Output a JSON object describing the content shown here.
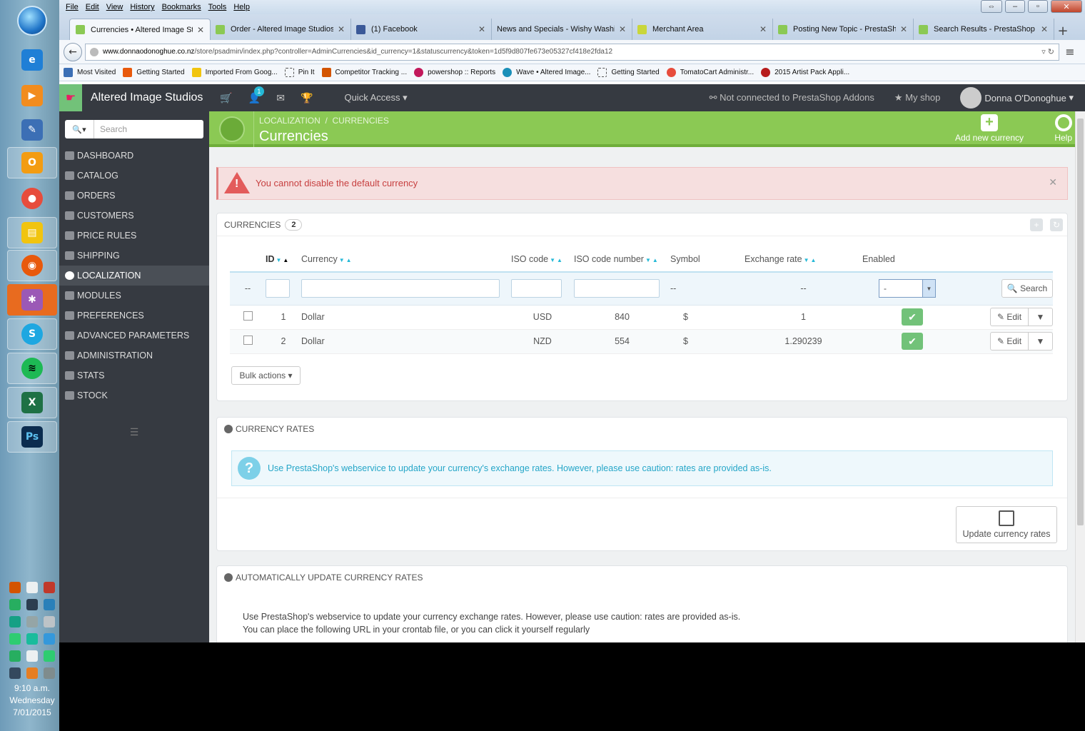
{
  "browser": {
    "menu": [
      "File",
      "Edit",
      "View",
      "History",
      "Bookmarks",
      "Tools",
      "Help"
    ],
    "tabs": [
      {
        "title": "Currencies • Altered Image St...",
        "active": true
      },
      {
        "title": "Order - Altered Image Studios",
        "active": false
      },
      {
        "title": "(1) Facebook",
        "active": false
      },
      {
        "title": "News and Specials - Wishy Washi",
        "active": false
      },
      {
        "title": "Merchant Area",
        "active": false
      },
      {
        "title": "Posting New Topic - PrestaSh...",
        "active": false
      },
      {
        "title": "Search Results - PrestaShop F...",
        "active": false
      }
    ],
    "url_domain": "www.donnaodonoghue.co.nz",
    "url_path": "/store/psadmin/index.php?controller=AdminCurrencies&id_currency=1&statuscurrency&token=1d5f9d807fe673e05327cf418e2fda12",
    "bookmarks": [
      "Most Visited",
      "Getting Started",
      "Imported From Goog...",
      "Pin It",
      "Competitor Tracking ...",
      "powershop :: Reports",
      "Wave • Altered Image...",
      "Getting Started",
      "TomatoCart Administr...",
      "2015 Artist Pack Appli..."
    ]
  },
  "taskbar": {
    "clock_time": "9:10 a.m.",
    "clock_day": "Wednesday",
    "clock_date": "7/01/2015"
  },
  "ps": {
    "brand": "Altered Image Studios",
    "notif_count": "1",
    "quick_access": "Quick Access",
    "addons": "Not connected to PrestaShop Addons",
    "my_shop": "My shop",
    "user": "Donna O'Donoghue",
    "search_placeholder": "Search",
    "nav": [
      "DASHBOARD",
      "CATALOG",
      "ORDERS",
      "CUSTOMERS",
      "PRICE RULES",
      "SHIPPING",
      "LOCALIZATION",
      "MODULES",
      "PREFERENCES",
      "ADVANCED PARAMETERS",
      "ADMINISTRATION",
      "STATS",
      "STOCK"
    ],
    "breadcrumb_1": "LOCALIZATION",
    "breadcrumb_sep": "/",
    "breadcrumb_2": "CURRENCIES",
    "page_title": "Currencies",
    "add_btn": "Add new currency",
    "help_btn": "Help",
    "alert": "You cannot disable the default currency",
    "currencies_panel": {
      "title": "CURRENCIES",
      "count": "2",
      "headers": [
        "ID",
        "Currency",
        "ISO code",
        "ISO code number",
        "Symbol",
        "Exchange rate",
        "Enabled"
      ],
      "filter_dash": "--",
      "enabled_filter": "-",
      "search_btn": "Search",
      "rows": [
        {
          "id": "1",
          "currency": "Dollar",
          "iso": "USD",
          "iso_num": "840",
          "symbol": "$",
          "rate": "1"
        },
        {
          "id": "2",
          "currency": "Dollar",
          "iso": "NZD",
          "iso_num": "554",
          "symbol": "$",
          "rate": "1.290239"
        }
      ],
      "edit_label": "Edit",
      "bulk": "Bulk actions"
    },
    "rates_panel": {
      "title": "CURRENCY RATES",
      "info": "Use PrestaShop's webservice to update your currency's exchange rates. However, please use caution: rates are provided as-is.",
      "update_btn": "Update currency rates"
    },
    "auto_panel": {
      "title": "AUTOMATICALLY UPDATE CURRENCY RATES",
      "line1": "Use PrestaShop's webservice to update your currency exchange rates. However, please use caution: rates are provided as-is.",
      "line2": "You can place the following URL in your crontab file, or you can click it yourself regularly"
    }
  }
}
